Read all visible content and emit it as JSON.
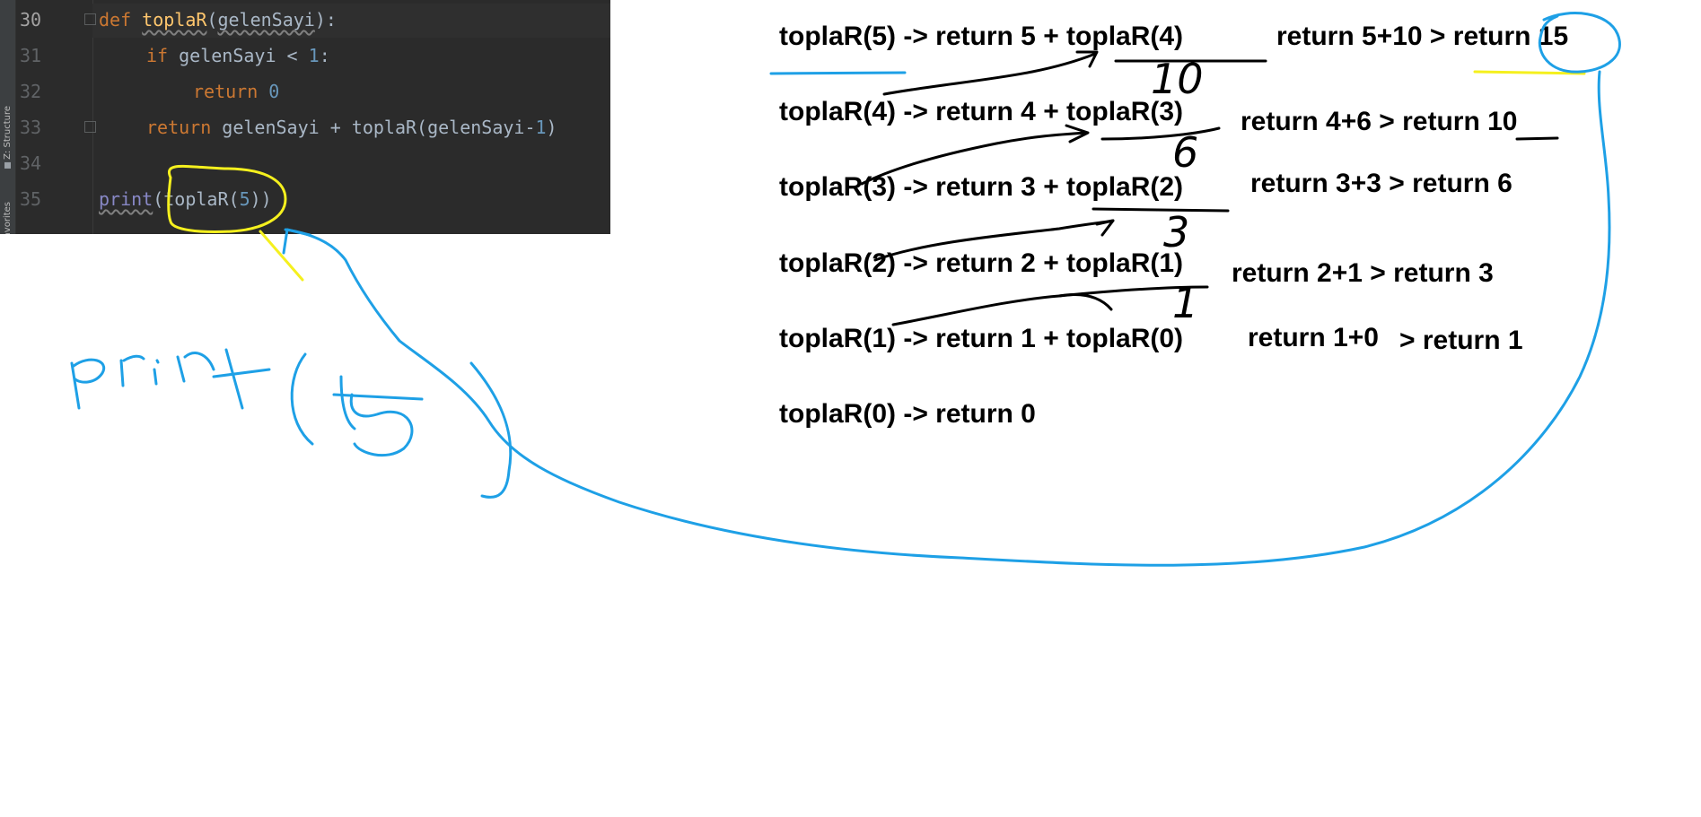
{
  "editor": {
    "side_tabs": {
      "structure": "Z: Structure",
      "favorites": "Favorites"
    },
    "line_numbers": [
      "30",
      "31",
      "32",
      "33",
      "34",
      "35"
    ],
    "code": {
      "l30": {
        "kw": "def",
        "fn": "toplaR",
        "open": "(",
        "param": "gelenSayi",
        "close": "):"
      },
      "l31": {
        "kw": "if",
        "rest": " gelenSayi < ",
        "num": "1",
        "colon": ":"
      },
      "l32": {
        "kw": "return",
        "num": "0"
      },
      "l33": {
        "kw": "return",
        "rest": " gelenSayi + toplaR(gelenSayi-",
        "num": "1",
        "close": ")"
      },
      "l35": {
        "builtin": "print",
        "open": "(",
        "call": "toplaR(",
        "num": "5",
        "close": "))"
      }
    }
  },
  "recursion": {
    "calls": [
      "toplaR(5) -> return 5 + toplaR(4)",
      "toplaR(4) -> return 4 + toplaR(3)",
      "toplaR(3) -> return 3 + toplaR(2)",
      "toplaR(2) -> return 2 + toplaR(1)",
      "toplaR(1) -> return 1 + toplaR(0)",
      "toplaR(0) -> return 0"
    ],
    "results": [
      "return 5+10 > return 15",
      "return 4+6 > return 10",
      "return 3+3 > return 6",
      "return 2+1 > return 3",
      "return 1+0",
      "> return 1"
    ]
  },
  "annotations": {
    "handwritten_values": [
      "10",
      "6",
      "3",
      "1"
    ],
    "print_note": "print(15)"
  },
  "colors": {
    "editor_bg": "#2b2b2b",
    "pen_black": "#000000",
    "pen_blue": "#1ea0e6",
    "pen_yellow": "#f5f01e"
  }
}
